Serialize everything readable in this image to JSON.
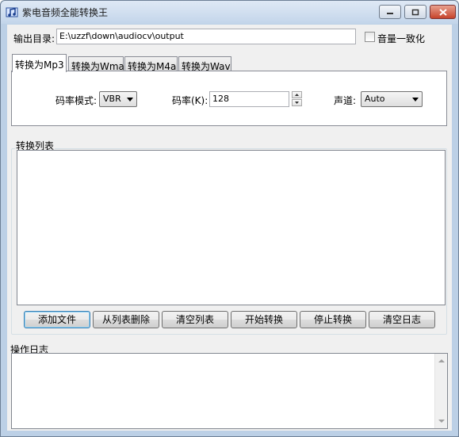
{
  "window": {
    "title": "紫电音频全能转换王",
    "icons": {
      "app": "music-note-icon",
      "minimize": "minimize-icon",
      "maximize": "maximize-icon",
      "close": "close-icon"
    },
    "colors": {
      "titlebar": "#c3d5ea",
      "close": "#c6442b",
      "client": "#f0f0f0"
    }
  },
  "output": {
    "label": "输出目录:",
    "path": "E:\\uzzf\\down\\audiocv\\output",
    "normalize_label": "音量一致化",
    "normalize_checked": false
  },
  "tabs": [
    {
      "label": "转换为Mp3",
      "active": true
    },
    {
      "label": "转换为Wma",
      "active": false
    },
    {
      "label": "转换为M4a",
      "active": false
    },
    {
      "label": "转换为Wav",
      "active": false
    }
  ],
  "settings": {
    "mode_label": "码率模式:",
    "mode_value": "VBR",
    "bitrate_label": "码率(K):",
    "bitrate_value": "128",
    "channel_label": "声道:",
    "channel_value": "Auto"
  },
  "conversion_list": {
    "title": "转换列表",
    "items": []
  },
  "buttons": {
    "add_file": "添加文件",
    "remove_from_list": "从列表删除",
    "clear_list": "清空列表",
    "start_convert": "开始转换",
    "stop_convert": "停止转换",
    "clear_log": "清空日志"
  },
  "log": {
    "title": "操作日志",
    "content": ""
  }
}
